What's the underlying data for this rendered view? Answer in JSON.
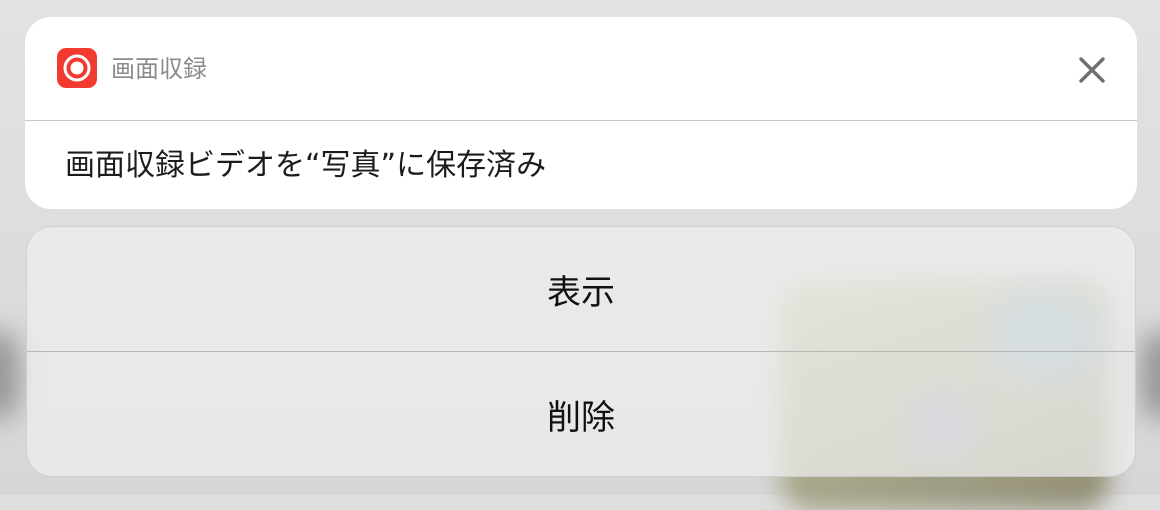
{
  "notification": {
    "app_name": "画面収録",
    "app_icon": "screen-recording-icon",
    "close_icon": "close-icon",
    "message": "画面収録ビデオを“写真”に保存済み",
    "accent_color": "#f23b30"
  },
  "actions": [
    {
      "label": "表示"
    },
    {
      "label": "削除"
    }
  ]
}
